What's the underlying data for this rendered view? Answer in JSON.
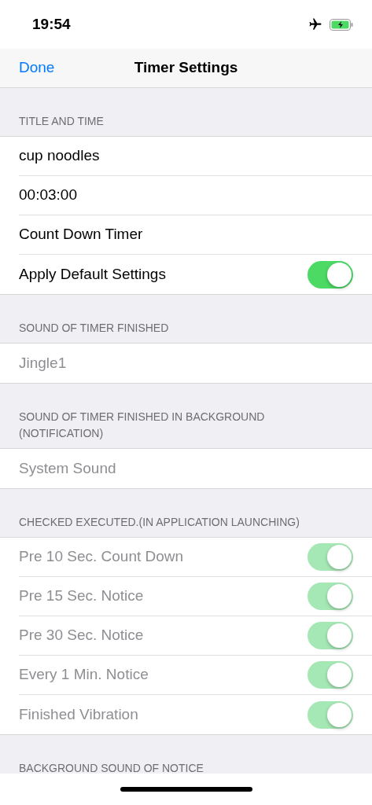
{
  "status_bar": {
    "time": "19:54"
  },
  "nav": {
    "back": "Done",
    "title": "Timer Settings"
  },
  "sections": [
    {
      "header": "TITLE AND TIME",
      "rows": [
        {
          "kind": "text",
          "label": "cup noodles",
          "disabled": false
        },
        {
          "kind": "text",
          "label": "00:03:00",
          "disabled": false
        },
        {
          "kind": "text",
          "label": "Count Down Timer",
          "disabled": false
        },
        {
          "kind": "toggle",
          "label": "Apply Default Settings",
          "disabled": false,
          "on": true
        }
      ]
    },
    {
      "header": "SOUND OF TIMER FINISHED",
      "rows": [
        {
          "kind": "text",
          "label": "Jingle1",
          "disabled": true
        }
      ]
    },
    {
      "header": "SOUND OF TIMER FINISHED IN BACKGROUND (NOTIFICATION)",
      "rows": [
        {
          "kind": "text",
          "label": "System Sound",
          "disabled": true
        }
      ]
    },
    {
      "header": "CHECKED EXECUTED.(IN APPLICATION LAUNCHING)",
      "rows": [
        {
          "kind": "toggle",
          "label": "Pre 10 Sec. Count Down",
          "disabled": true,
          "on": true
        },
        {
          "kind": "toggle",
          "label": "Pre 15 Sec. Notice",
          "disabled": true,
          "on": true
        },
        {
          "kind": "toggle",
          "label": "Pre 30 Sec. Notice",
          "disabled": true,
          "on": true
        },
        {
          "kind": "toggle",
          "label": "Every 1 Min. Notice",
          "disabled": true,
          "on": true
        },
        {
          "kind": "toggle",
          "label": "Finished Vibration",
          "disabled": true,
          "on": true
        }
      ]
    },
    {
      "header": "BACKGROUND SOUND OF NOTICE"
    }
  ]
}
